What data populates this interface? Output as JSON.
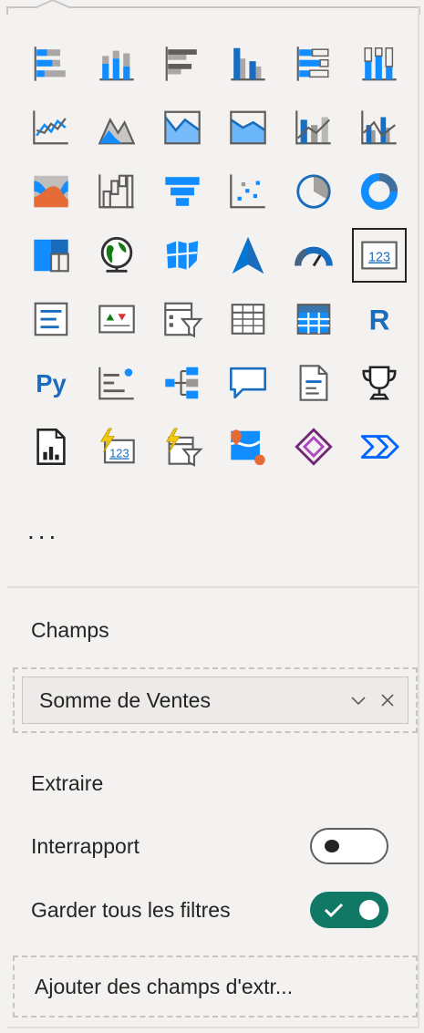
{
  "colors": {
    "accent_blue": "#118dff",
    "dark_blue": "#1a6dbd",
    "gray": "#605e5c",
    "toggle_on": "#117865",
    "panel_bg": "#f3f2f1"
  },
  "visuals": [
    {
      "name": "stacked-bar-chart-icon"
    },
    {
      "name": "stacked-column-chart-icon"
    },
    {
      "name": "clustered-bar-chart-icon"
    },
    {
      "name": "clustered-column-chart-icon"
    },
    {
      "name": "100-stacked-bar-chart-icon"
    },
    {
      "name": "100-stacked-column-chart-icon"
    },
    {
      "name": "line-chart-icon"
    },
    {
      "name": "area-chart-icon"
    },
    {
      "name": "stacked-area-chart-icon"
    },
    {
      "name": "100-stacked-area-chart-icon"
    },
    {
      "name": "line-and-stacked-column-chart-icon"
    },
    {
      "name": "line-and-clustered-column-chart-icon"
    },
    {
      "name": "ribbon-chart-icon"
    },
    {
      "name": "waterfall-chart-icon"
    },
    {
      "name": "funnel-chart-icon"
    },
    {
      "name": "scatter-chart-icon"
    },
    {
      "name": "pie-chart-icon"
    },
    {
      "name": "donut-chart-icon"
    },
    {
      "name": "treemap-icon"
    },
    {
      "name": "map-icon"
    },
    {
      "name": "filled-map-icon"
    },
    {
      "name": "azure-map-icon"
    },
    {
      "name": "gauge-icon"
    },
    {
      "name": "card-icon",
      "label": "123",
      "selected": true
    },
    {
      "name": "multi-row-card-icon"
    },
    {
      "name": "kpi-icon"
    },
    {
      "name": "slicer-icon"
    },
    {
      "name": "table-icon"
    },
    {
      "name": "matrix-icon"
    },
    {
      "name": "r-script-visual-icon",
      "label": "R"
    },
    {
      "name": "python-visual-icon",
      "label": "Py"
    },
    {
      "name": "key-influencers-icon"
    },
    {
      "name": "decomposition-tree-icon"
    },
    {
      "name": "qa-icon"
    },
    {
      "name": "smart-narrative-icon"
    },
    {
      "name": "trophy-goals-icon"
    },
    {
      "name": "paginated-report-icon"
    },
    {
      "name": "power-card-icon",
      "label": "123"
    },
    {
      "name": "power-slicer-icon"
    },
    {
      "name": "arcgis-map-icon"
    },
    {
      "name": "power-apps-icon"
    },
    {
      "name": "power-automate-icon"
    }
  ],
  "more_label": "...",
  "fields": {
    "title": "Champs",
    "value": "Somme de Ventes",
    "chevron_icon": "chevron-down-icon",
    "remove_icon": "close-icon"
  },
  "drillthrough": {
    "title": "Extraire",
    "cross_report_label": "Interrapport",
    "cross_report_on": false,
    "keep_filters_label": "Garder tous les filtres",
    "keep_filters_on": true,
    "add_fields_placeholder": "Ajouter des champs d'extr..."
  }
}
